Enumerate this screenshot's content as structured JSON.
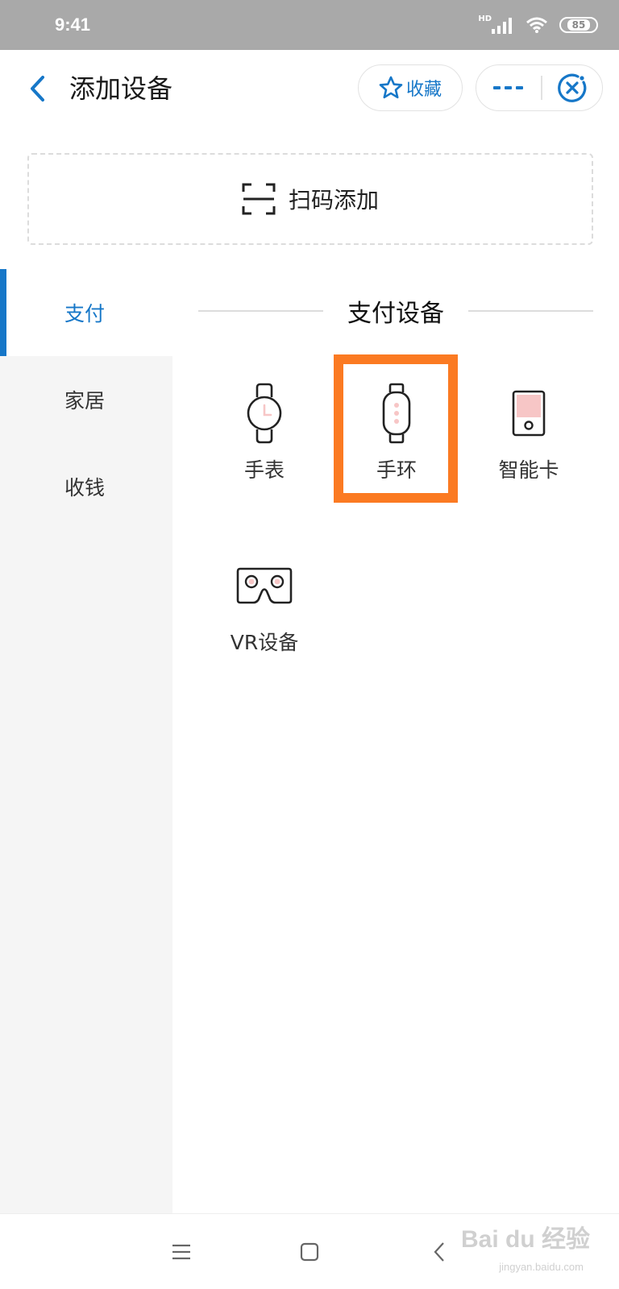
{
  "status_bar": {
    "time": "9:41",
    "network": "HD",
    "battery": "85"
  },
  "header": {
    "title": "添加设备",
    "favorite_label": "收藏"
  },
  "scan": {
    "label": "扫码添加"
  },
  "sidebar": {
    "items": [
      {
        "label": "支付",
        "active": true
      },
      {
        "label": "家居",
        "active": false
      },
      {
        "label": "收钱",
        "active": false
      }
    ]
  },
  "content": {
    "section_title": "支付设备",
    "devices": [
      {
        "label": "手表",
        "icon": "watch-icon"
      },
      {
        "label": "手环",
        "icon": "band-icon",
        "highlighted": true
      },
      {
        "label": "智能卡",
        "icon": "smart-card-icon"
      },
      {
        "label": "VR设备",
        "icon": "vr-headset-icon"
      }
    ]
  },
  "watermark": {
    "brand": "Bai du 经验",
    "domain": "jingyan.baidu.com"
  },
  "colors": {
    "accent": "#1677c8",
    "highlight": "#fb7a22",
    "icon_pink": "#f7c6c6"
  }
}
